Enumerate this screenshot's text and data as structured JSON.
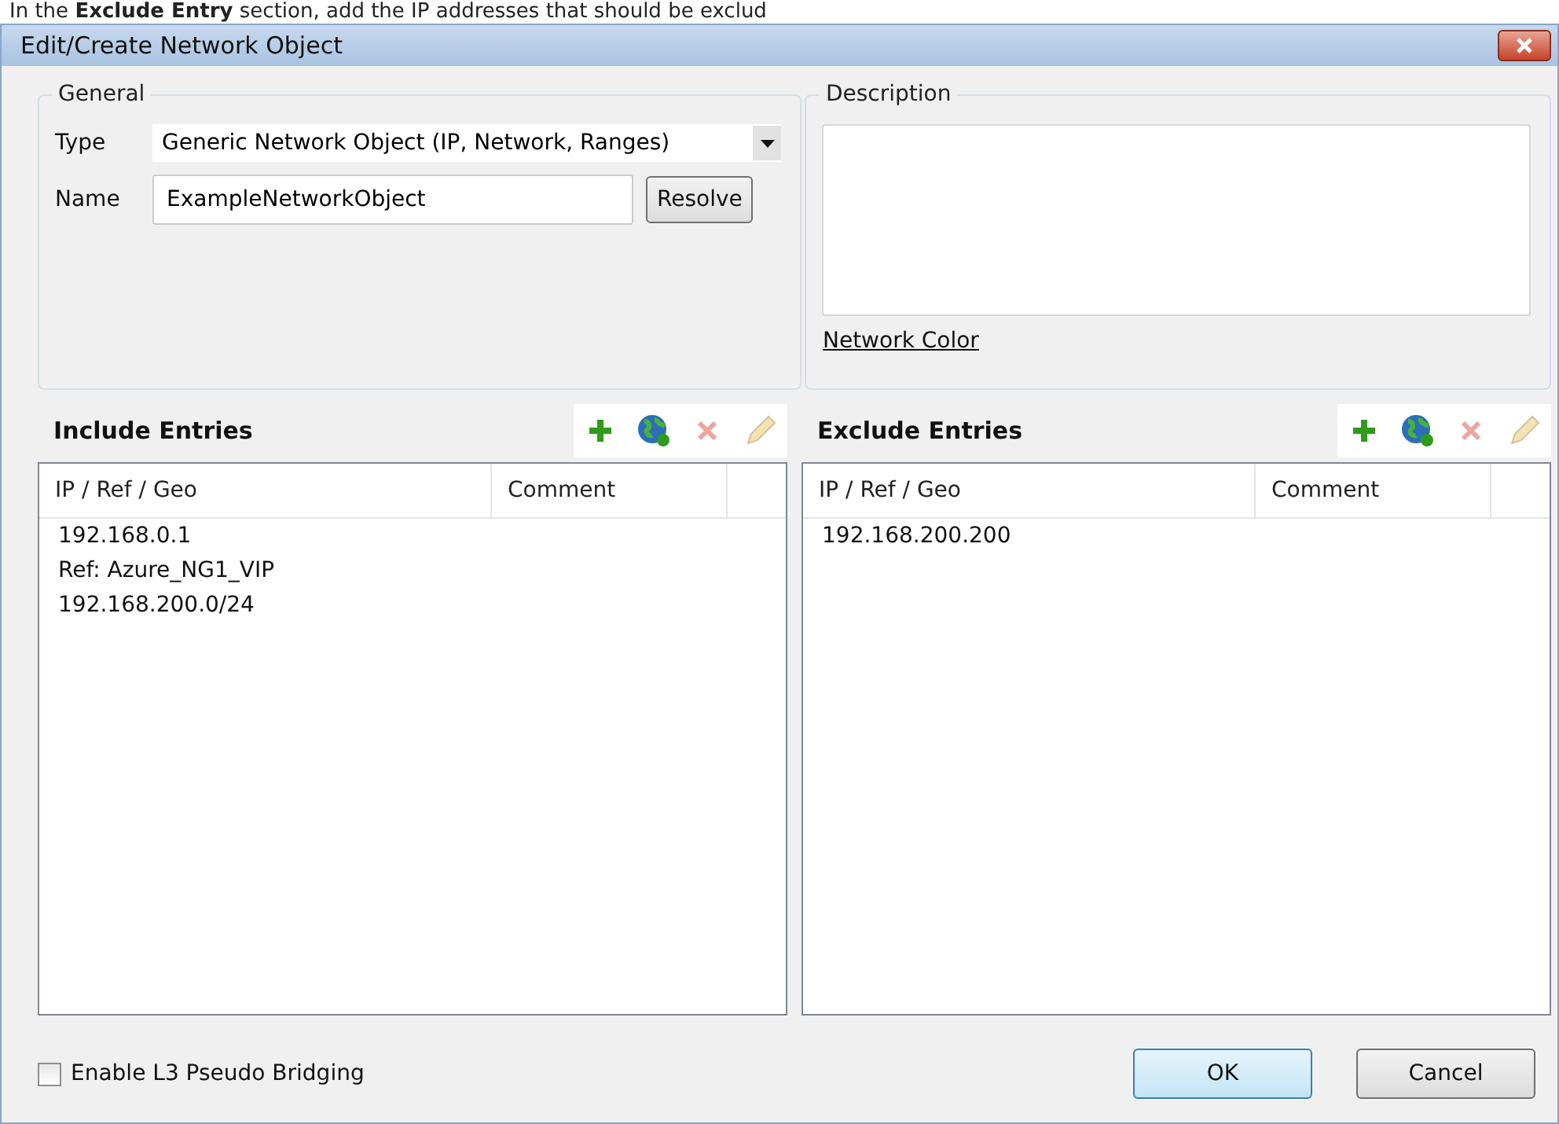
{
  "caption": "In the **Exclude Entry** section, add the IP addresses that should be exclud",
  "window": {
    "title": "Edit/Create Network Object"
  },
  "general": {
    "legend": "General",
    "type_label": "Type",
    "type_value": "Generic Network Object (IP, Network, Ranges)",
    "name_label": "Name",
    "name_value": "ExampleNetworkObject",
    "resolve_button": "Resolve"
  },
  "description": {
    "legend": "Description",
    "link": "Network Color"
  },
  "panels": [
    {
      "title": "Include Entries",
      "tools": [
        {
          "kind": "add",
          "disabled": false
        },
        {
          "kind": "globe",
          "disabled": false
        },
        {
          "kind": "delete",
          "disabled": true
        },
        {
          "kind": "edit",
          "disabled": true
        }
      ],
      "columns": [
        "IP / Ref / Geo",
        "Comment"
      ],
      "rows": [
        "192.168.0.1",
        "Ref: Azure_NG1_VIP",
        "192.168.200.0/24"
      ]
    },
    {
      "title": "Exclude Entries",
      "tools": [
        {
          "kind": "add",
          "disabled": false
        },
        {
          "kind": "globe",
          "disabled": false
        },
        {
          "kind": "delete",
          "disabled": true
        },
        {
          "kind": "edit",
          "disabled": true
        }
      ],
      "columns": [
        "IP / Ref / Geo",
        "Comment"
      ],
      "rows": [
        "192.168.200.200"
      ]
    }
  ],
  "bridging": {
    "label": "Enable L3 Pseudo Bridging",
    "checked": false
  },
  "buttons": [
    {
      "label": "OK",
      "default": true
    },
    {
      "label": "Cancel",
      "default": false
    }
  ]
}
